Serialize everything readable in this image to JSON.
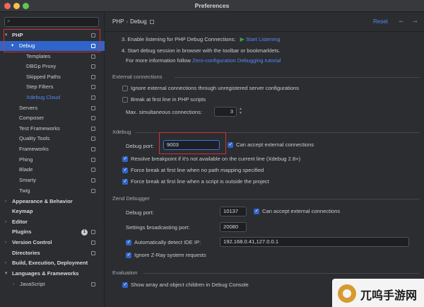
{
  "window": {
    "title": "Preferences"
  },
  "sidebar": {
    "search_placeholder": "",
    "items": [
      {
        "label": "PHP",
        "arrow": "▾"
      },
      {
        "label": "Debug",
        "arrow": "▾"
      },
      {
        "label": "Templates"
      },
      {
        "label": "DBGp Proxy"
      },
      {
        "label": "Skipped Paths"
      },
      {
        "label": "Step Filters"
      },
      {
        "label": "Xdebug Cloud"
      },
      {
        "label": "Servers"
      },
      {
        "label": "Composer"
      },
      {
        "label": "Test Frameworks"
      },
      {
        "label": "Quality Tools"
      },
      {
        "label": "Frameworks"
      },
      {
        "label": "Phing"
      },
      {
        "label": "Blade"
      },
      {
        "label": "Smarty"
      },
      {
        "label": "Twig"
      },
      {
        "label": "Appearance & Behavior",
        "arrow": "›"
      },
      {
        "label": "Keymap"
      },
      {
        "label": "Editor",
        "arrow": "›"
      },
      {
        "label": "Plugins",
        "badge": "1"
      },
      {
        "label": "Version Control",
        "arrow": "›"
      },
      {
        "label": "Directories"
      },
      {
        "label": "Build, Execution, Deployment",
        "arrow": "›"
      },
      {
        "label": "Languages & Frameworks",
        "arrow": "▾"
      },
      {
        "label": "JavaScript",
        "arrow": "›"
      }
    ]
  },
  "header": {
    "breadcrumb_parent": "PHP",
    "breadcrumb_sep": "›",
    "breadcrumb_current": "Debug",
    "reset": "Reset",
    "back": "←",
    "forward": "→"
  },
  "steps": {
    "line2_prefix": "3. Enable listening for PHP Debug Connections:",
    "line2_link": "Start Listening",
    "line3": "4. Start debug session in browser with the toolbar or bookmarklets.",
    "line4_prefix": "For more information follow",
    "line4_link": "Zero-configuration Debugging tutorial"
  },
  "external": {
    "title": "External connections",
    "ignore_label": "Ignore external connections through unregistered server configurations",
    "break_label": "Break at first line in PHP scripts",
    "max_label": "Max. simultaneous connections:",
    "max_value": "3"
  },
  "xdebug": {
    "title": "Xdebug",
    "port_label": "Debug port:",
    "port_value": "9003",
    "accept_label": "Can accept external connections",
    "resolve_label": "Resolve breakpoint if it's not available on the current line (Xdebug 2.8+)",
    "force1_label": "Force break at first line when no path mapping specified",
    "force2_label": "Force break at first line when a script is outside the project"
  },
  "zend": {
    "title": "Zend Debugger",
    "port_label": "Debug port:",
    "port_value": "10137",
    "accept_label": "Can accept external connections",
    "broadcast_label": "Settings broadcasting port:",
    "broadcast_value": "20080",
    "detect_label": "Automatically detect IDE IP:",
    "detect_value": "192.168.0.41,127.0.0.1",
    "ignore_label": "Ignore Z-Ray system requests"
  },
  "evaluation": {
    "title": "Evaluation",
    "show_label": "Show array and object children in Debug Console"
  },
  "watermark": {
    "text": "兀呜手游网"
  }
}
